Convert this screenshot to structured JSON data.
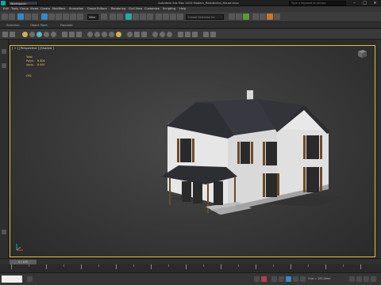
{
  "titlebar": {
    "workspace": "Workspace: Default",
    "title": "Autodesk 3ds Max 2016    Modern_Residential_House.max",
    "search_placeholder": "Type a keyword or phrase"
  },
  "menu": [
    "Edit",
    "Tools",
    "Group",
    "Views",
    "Create",
    "Modifiers",
    "Animation",
    "Graph Editors",
    "Rendering",
    "Civil View",
    "Customize",
    "Scripting",
    "Help"
  ],
  "toolbar": {
    "view_mode": "View",
    "selection_set": "Create Selection Se"
  },
  "ribbon_tabs": [
    "Selection",
    "Object Paint",
    "Populate"
  ],
  "viewport": {
    "label": "[ + ] [Perspective ] [Shaded ]",
    "stats_total": "Total",
    "polys_label": "Polys:",
    "polys_value": "6 604",
    "verts_label": "Verts:",
    "verts_value": "6 997",
    "fps_label": "FPS:"
  },
  "timeline": {
    "frame": "0 / 100",
    "grid": "Grid = 100,0mm"
  },
  "colors": {
    "viewport_border": "#d8c238",
    "stats_text": "#e8c85a",
    "house_wall": "#e4e4e4",
    "house_roof": "#2d2d33",
    "window_shutter": "#6b4a2a"
  }
}
